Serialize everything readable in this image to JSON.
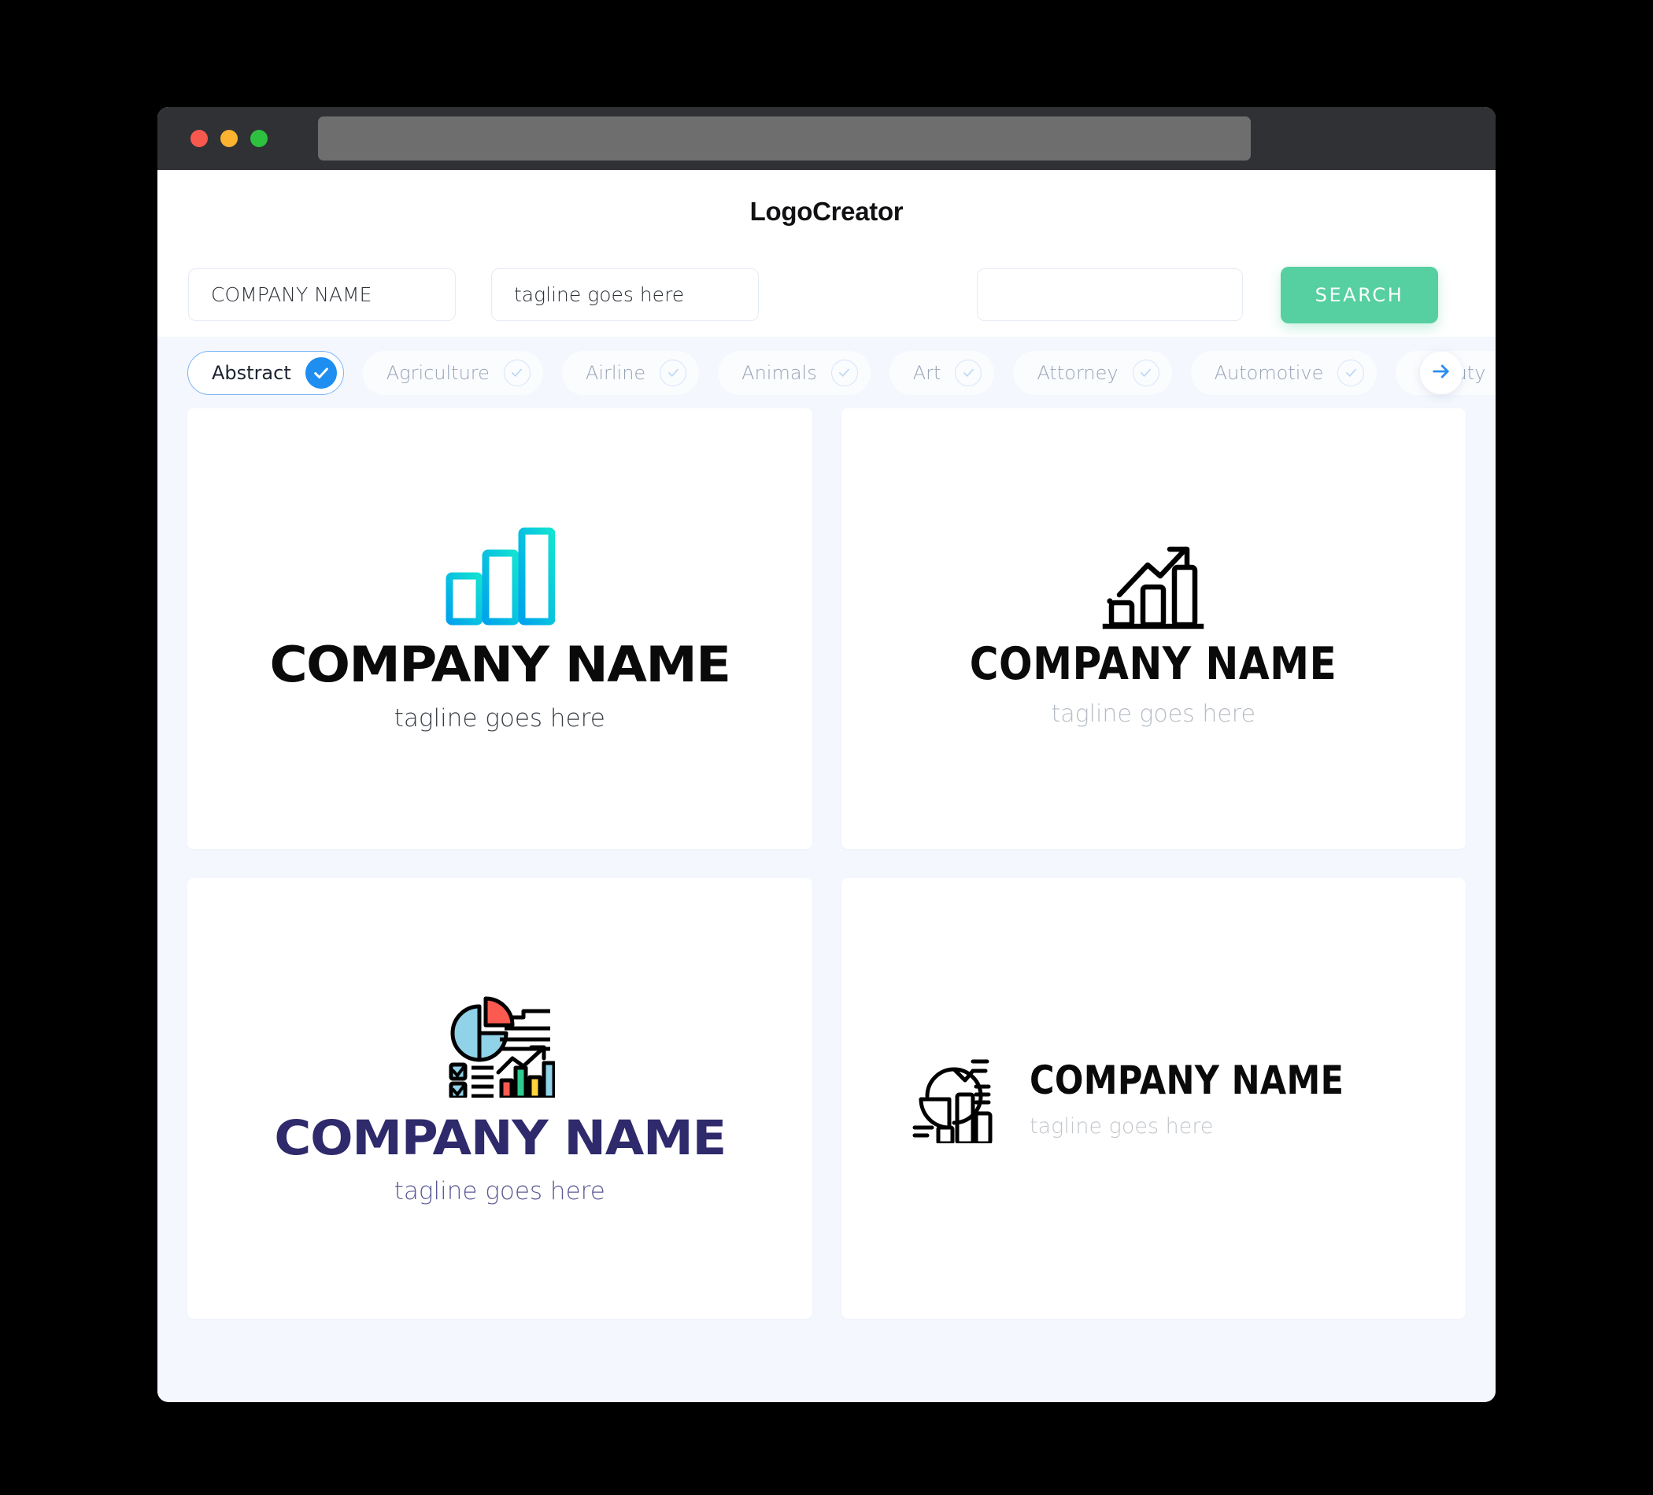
{
  "window": {
    "traffic_lights": [
      "close",
      "minimize",
      "maximize"
    ],
    "url_value": ""
  },
  "header": {
    "app_title": "LogoCreator"
  },
  "search": {
    "company_value": "COMPANY NAME",
    "company_placeholder": "COMPANY NAME",
    "tagline_value": "tagline goes here",
    "tagline_placeholder": "tagline goes here",
    "extra_value": "",
    "extra_placeholder": "",
    "search_button": "SEARCH"
  },
  "categories": {
    "next_icon": "arrow-right-icon",
    "items": [
      {
        "label": "Abstract",
        "selected": true
      },
      {
        "label": "Agriculture",
        "selected": false
      },
      {
        "label": "Airline",
        "selected": false
      },
      {
        "label": "Animals",
        "selected": false
      },
      {
        "label": "Art",
        "selected": false
      },
      {
        "label": "Attorney",
        "selected": false
      },
      {
        "label": "Automotive",
        "selected": false
      },
      {
        "label": "Beauty",
        "selected": false
      }
    ]
  },
  "results": {
    "cards": [
      {
        "icon": "bar-chart-gradient-icon",
        "company_name": "COMPANY NAME",
        "tagline": "tagline goes here",
        "name_color": "#0a0a0a",
        "tagline_color": "#3a3f47",
        "accent_color": "#0fd3e0"
      },
      {
        "icon": "growth-arrow-chart-icon",
        "company_name": "COMPANY NAME",
        "tagline": "tagline goes here",
        "name_color": "#0a0a0a",
        "tagline_color": "#b6bcc4",
        "accent_color": "#000000"
      },
      {
        "icon": "infographic-pie-bars-icon",
        "company_name": "COMPANY NAME",
        "tagline": "tagline goes here",
        "name_color": "#2e2a6b",
        "tagline_color": "#5b5a95",
        "accent_color": "#7ec8e3"
      },
      {
        "icon": "pie-slice-bars-outline-icon",
        "company_name": "COMPANY NAME",
        "tagline": "tagline goes here",
        "name_color": "#0a0a0a",
        "tagline_color": "#c2c6cb",
        "accent_color": "#000000"
      }
    ]
  },
  "theme": {
    "page_background": "#f4f7fd",
    "card_background": "#ffffff",
    "search_button_color": "#56cfa1",
    "chip_active_color": "#1e8ef1",
    "titlebar_color": "#2f3135"
  }
}
